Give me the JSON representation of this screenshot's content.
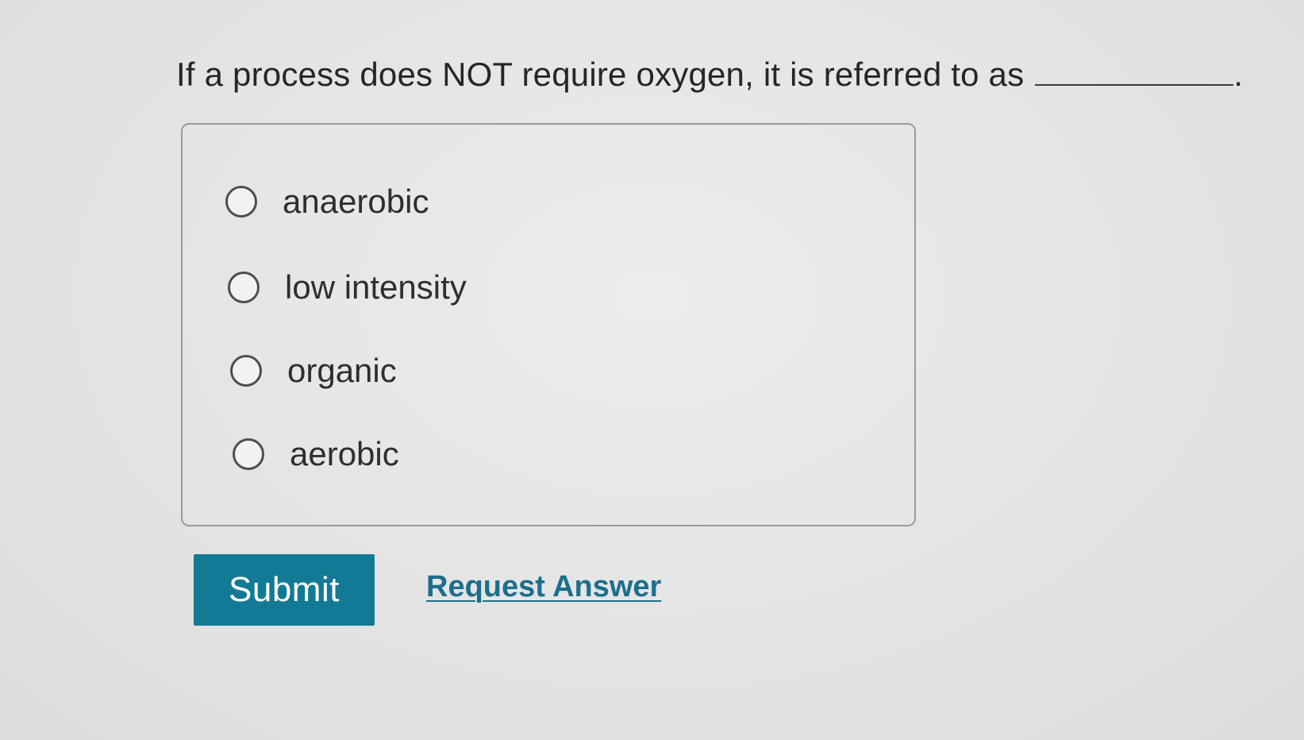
{
  "question": {
    "text": "If a process does NOT require oxygen, it is referred to as",
    "trailing": "."
  },
  "options": [
    {
      "label": "anaerobic",
      "selected": false
    },
    {
      "label": "low intensity",
      "selected": false
    },
    {
      "label": "organic",
      "selected": false
    },
    {
      "label": "aerobic",
      "selected": false
    }
  ],
  "actions": {
    "submit_label": "Submit",
    "request_answer_label": "Request Answer"
  },
  "colors": {
    "submit_bg": "#137a95",
    "link": "#1c6f8c"
  }
}
